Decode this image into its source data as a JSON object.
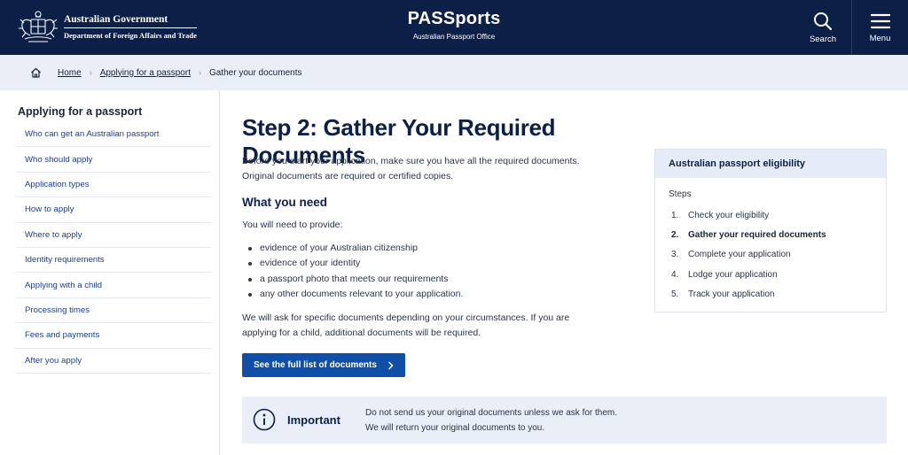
{
  "header": {
    "gov_name": "Australian Government",
    "gov_dept": "Department of Foreign Affairs and Trade",
    "site_title": "PASSports",
    "site_subtitle": "Australian Passport Office",
    "search_label": "Search",
    "menu_label": "Menu"
  },
  "breadcrumb": {
    "home_icon": "home-icon",
    "items": [
      "Home",
      "Applying for a passport",
      "Gather your documents"
    ]
  },
  "sidebar": {
    "title": "Applying for a passport",
    "items": [
      "Who can get an Australian passport",
      "Who should apply",
      "Application types",
      "How to apply",
      "Where to apply",
      "Identity requirements",
      "Applying with a child",
      "Processing times",
      "Fees and payments",
      "After you apply"
    ]
  },
  "main": {
    "heading": "Step 2: Gather Your Required Documents",
    "intro_line1": "Before you start your application, make sure you have all the required documents.",
    "intro_line2": "Original documents are required or certified copies.",
    "subheading": "What you need",
    "provide": "You will need to provide:",
    "needs": [
      "evidence of your Australian citizenship",
      "evidence of your identity",
      "a passport photo that meets our requirements",
      "any other documents relevant to your application."
    ],
    "note_line1": "We will ask for specific documents depending on your circumstances. If you are",
    "note_line2": "applying for a child, additional documents will be required.",
    "cta_label": "See the full list of documents"
  },
  "eligibility": {
    "title": "Australian passport eligibility",
    "steps_label": "Steps",
    "steps": [
      {
        "num": "1.",
        "label": "Check your eligibility"
      },
      {
        "num": "2.",
        "label": "Gather your required documents"
      },
      {
        "num": "3.",
        "label": "Complete your application"
      },
      {
        "num": "4.",
        "label": "Lodge your application"
      },
      {
        "num": "5.",
        "label": "Track your application"
      }
    ],
    "current_step": 2
  },
  "callout": {
    "icon": "info-icon",
    "title": "Important",
    "line1": "Do not send us your original documents unless we ask for them.",
    "line2": "We will return your original documents to you."
  },
  "colors": {
    "header_bg": "#0c1f47",
    "accent": "#0f4fa8",
    "panel_bg": "#e9eef7",
    "link": "#1b3d8f"
  }
}
